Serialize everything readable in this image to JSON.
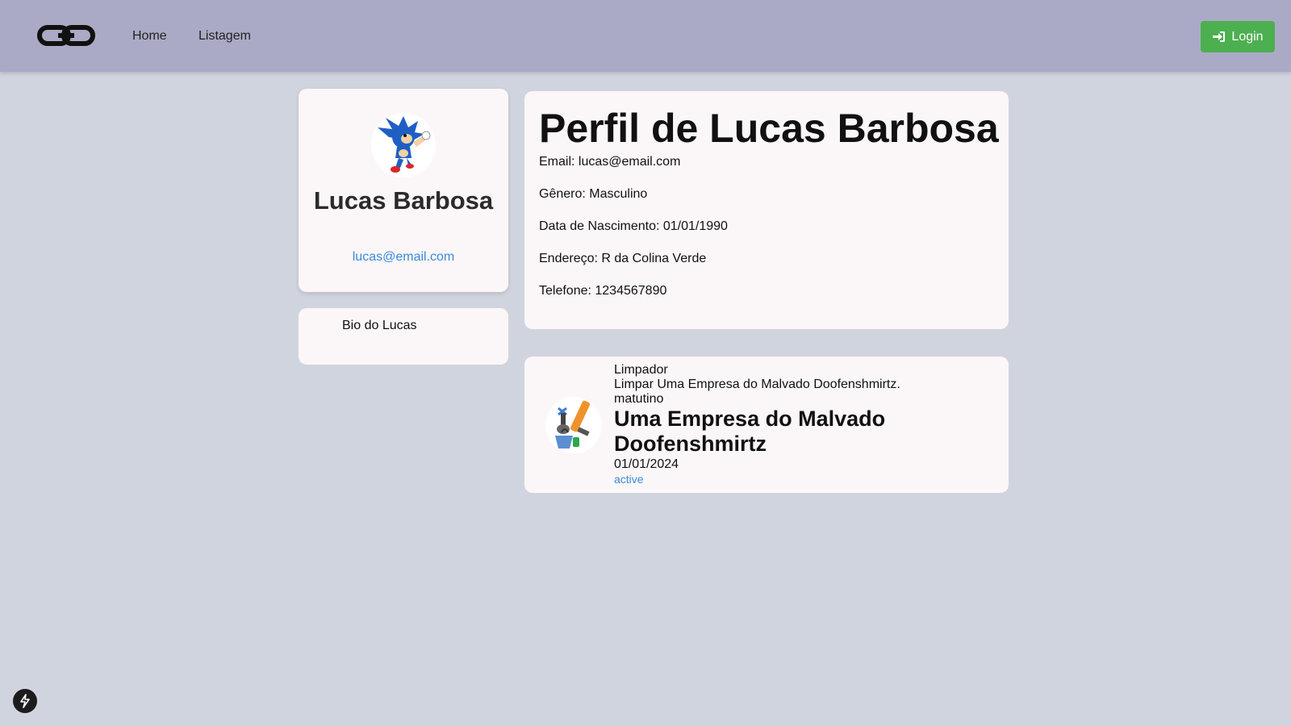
{
  "navbar": {
    "logo_icon": "chain-link-icon",
    "links": [
      {
        "label": "Home"
      },
      {
        "label": "Listagem"
      }
    ],
    "login": {
      "label": "Login",
      "icon": "sign-in-icon",
      "color": "#4caf50"
    }
  },
  "profile": {
    "avatar_icon": "sonic-avatar",
    "name": "Lucas Barbosa",
    "email": "lucas@email.com"
  },
  "bio": {
    "text": "Bio do Lucas"
  },
  "details": {
    "title": "Perfil de Lucas Barbosa",
    "email": "Email: lucas@email.com",
    "gender": "Gênero: Masculino",
    "birthdate": "Data de Nascimento: 01/01/1990",
    "address": "Endereço: R da Colina Verde",
    "phone": "Telefone: 1234567890"
  },
  "job": {
    "icon": "cleaning-tools-icon",
    "role": "Limpador",
    "description": "Limpar Uma Empresa do Malvado Doofenshmirtz.",
    "shift": "matutino",
    "company": "Uma Empresa do Malvado Doofenshmirtz",
    "date": "01/01/2024",
    "status": "active"
  },
  "dev_indicator": {
    "icon": "lightning-bolt-icon"
  },
  "colors": {
    "navbar_bg": "#aaaac6",
    "page_bg": "#d0d4de",
    "card_bg": "#fbf6f8",
    "link_blue": "#3a8ad6"
  }
}
